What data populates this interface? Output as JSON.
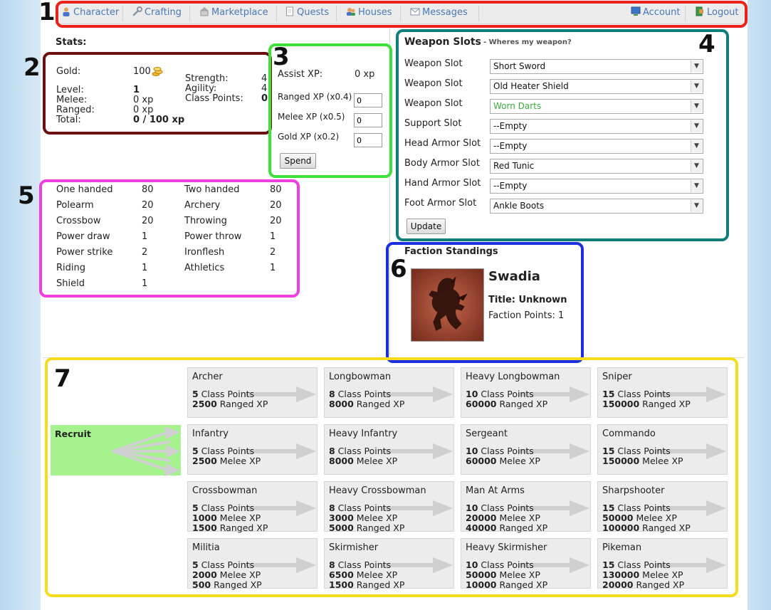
{
  "nav": {
    "items": [
      {
        "label": "Character",
        "icon": "user-icon"
      },
      {
        "label": "Crafting",
        "icon": "wrench-icon"
      },
      {
        "label": "Marketplace",
        "icon": "market-icon"
      },
      {
        "label": "Quests",
        "icon": "document-icon"
      },
      {
        "label": "Houses",
        "icon": "houses-icon"
      },
      {
        "label": "Messages",
        "icon": "envelope-icon"
      }
    ],
    "account": "Account",
    "logout": "Logout"
  },
  "annotations": [
    "1",
    "2",
    "3",
    "4",
    "5",
    "6",
    "7"
  ],
  "annotation_colors": [
    "#e8231b",
    "#6b0f12",
    "#3ee03a",
    "#0f7d7a",
    "#ee3fe0",
    "#1c2fe0",
    "#f5dc1f"
  ],
  "stats": {
    "heading": "Stats:",
    "gold_label": "Gold:",
    "gold_value": "100",
    "level_label": "Level:",
    "level_value": "1",
    "melee_label": "Melee:",
    "melee_value": "0 xp",
    "ranged_label": "Ranged:",
    "ranged_value": "0 xp",
    "total_label": "Total:",
    "total_value": "0 / 100 xp",
    "strength_label": "Strength:",
    "strength_value": "4",
    "agility_label": "Agility:",
    "agility_value": "4",
    "class_points_label": "Class Points:",
    "class_points_value": "0"
  },
  "spend": {
    "assist_label": "Assist XP:",
    "assist_value": "0 xp",
    "ranged_label": "Ranged XP (x0.4)",
    "ranged_value": "0",
    "melee_label": "Melee XP (x0.5)",
    "melee_value": "0",
    "gold_label": "Gold XP (x0.2)",
    "gold_value": "0",
    "button": "Spend"
  },
  "skills": [
    {
      "name": "One handed",
      "value": "80"
    },
    {
      "name": "Two handed",
      "value": "80"
    },
    {
      "name": "Polearm",
      "value": "20"
    },
    {
      "name": "Archery",
      "value": "20"
    },
    {
      "name": "Crossbow",
      "value": "20"
    },
    {
      "name": "Throwing",
      "value": "20"
    },
    {
      "name": "Power draw",
      "value": "1"
    },
    {
      "name": "Power throw",
      "value": "1"
    },
    {
      "name": "Power strike",
      "value": "2"
    },
    {
      "name": "Ironflesh",
      "value": "2"
    },
    {
      "name": "Riding",
      "value": "1"
    },
    {
      "name": "Athletics",
      "value": "1"
    },
    {
      "name": "Shield",
      "value": "1"
    }
  ],
  "weapons": {
    "title": "Weapon Slots",
    "subtitle": "- Wheres my weapon?",
    "slots": [
      {
        "label": "Weapon Slot",
        "value": "Short Sword",
        "color": "#111111"
      },
      {
        "label": "Weapon Slot",
        "value": "Old Heater Shield",
        "color": "#111111"
      },
      {
        "label": "Weapon Slot",
        "value": "Worn Darts",
        "color": "#3fa83f"
      },
      {
        "label": "Support Slot",
        "value": "--Empty",
        "color": "#111111"
      },
      {
        "label": "Head Armor Slot",
        "value": "--Empty",
        "color": "#111111"
      },
      {
        "label": "Body Armor Slot",
        "value": "Red Tunic",
        "color": "#111111"
      },
      {
        "label": "Hand Armor Slot",
        "value": "--Empty",
        "color": "#111111"
      },
      {
        "label": "Foot Armor Slot",
        "value": "Ankle Boots",
        "color": "#111111"
      }
    ],
    "update_button": "Update"
  },
  "faction": {
    "heading": "Faction Standings",
    "name": "Swadia",
    "title": "Title: Unknown",
    "points": "Faction Points: 1"
  },
  "classes": {
    "root": "Recruit",
    "rows": [
      [
        {
          "name": "Archer",
          "reqs": [
            [
              "5",
              " Class Points"
            ],
            [
              "2500",
              " Ranged XP"
            ]
          ]
        },
        {
          "name": "Longbowman",
          "reqs": [
            [
              "8",
              " Class Points"
            ],
            [
              "8000",
              " Ranged XP"
            ]
          ]
        },
        {
          "name": "Heavy Longbowman",
          "reqs": [
            [
              "10",
              " Class Points"
            ],
            [
              "60000",
              " Ranged XP"
            ]
          ]
        },
        {
          "name": "Sniper",
          "reqs": [
            [
              "15",
              " Class Points"
            ],
            [
              "150000",
              " Ranged XP"
            ]
          ]
        }
      ],
      [
        {
          "name": "Infantry",
          "reqs": [
            [
              "5",
              " Class Points"
            ],
            [
              "2500",
              " Melee XP"
            ]
          ]
        },
        {
          "name": "Heavy Infantry",
          "reqs": [
            [
              "8",
              " Class Points"
            ],
            [
              "8000",
              " Melee XP"
            ]
          ]
        },
        {
          "name": "Sergeant",
          "reqs": [
            [
              "10",
              " Class Points"
            ],
            [
              "60000",
              " Melee XP"
            ]
          ]
        },
        {
          "name": "Commando",
          "reqs": [
            [
              "15",
              " Class Points"
            ],
            [
              "150000",
              " Melee XP"
            ]
          ]
        }
      ],
      [
        {
          "name": "Crossbowman",
          "reqs": [
            [
              "5",
              " Class Points"
            ],
            [
              "1000",
              " Melee XP"
            ],
            [
              "1500",
              " Ranged XP"
            ]
          ]
        },
        {
          "name": "Heavy Crossbowman",
          "reqs": [
            [
              "8",
              " Class Points"
            ],
            [
              "3000",
              " Melee XP"
            ],
            [
              "5000",
              " Ranged XP"
            ]
          ]
        },
        {
          "name": "Man At Arms",
          "reqs": [
            [
              "10",
              " Class Points"
            ],
            [
              "20000",
              " Melee XP"
            ],
            [
              "40000",
              " Ranged XP"
            ]
          ]
        },
        {
          "name": "Sharpshooter",
          "reqs": [
            [
              "15",
              " Class Points"
            ],
            [
              "50000",
              " Melee XP"
            ],
            [
              "100000",
              " Ranged XP"
            ]
          ]
        }
      ],
      [
        {
          "name": "Militia",
          "reqs": [
            [
              "5",
              " Class Points"
            ],
            [
              "2000",
              " Melee XP"
            ],
            [
              "500",
              " Ranged XP"
            ]
          ]
        },
        {
          "name": "Skirmisher",
          "reqs": [
            [
              "8",
              " Class Points"
            ],
            [
              "6500",
              " Melee XP"
            ],
            [
              "1500",
              " Ranged XP"
            ]
          ]
        },
        {
          "name": "Heavy Skirmisher",
          "reqs": [
            [
              "10",
              " Class Points"
            ],
            [
              "50000",
              " Melee XP"
            ],
            [
              "10000",
              " Ranged XP"
            ]
          ]
        },
        {
          "name": "Pikeman",
          "reqs": [
            [
              "15",
              " Class Points"
            ],
            [
              "130000",
              " Melee XP"
            ],
            [
              "20000",
              " Ranged XP"
            ]
          ]
        }
      ]
    ]
  }
}
